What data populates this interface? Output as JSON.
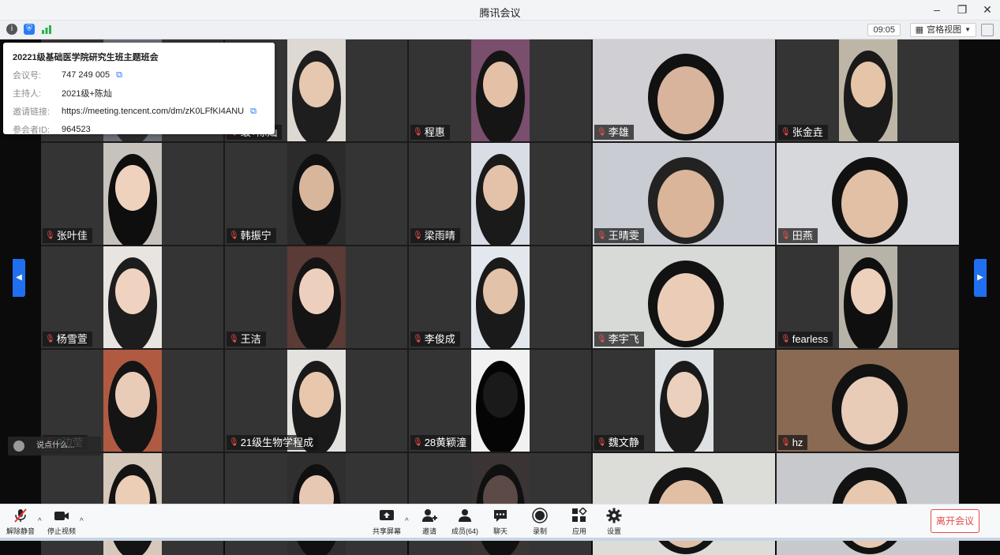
{
  "window": {
    "title": "腾讯会议"
  },
  "subbar": {
    "clock": "09:05",
    "view_label": "宫格视图"
  },
  "meeting_info": {
    "title": "20221级基础医学院研究生班主题班会",
    "rows": [
      {
        "key": "会议号:",
        "value": "747 249 005"
      },
      {
        "key": "主持人:",
        "value": "2021级+陈灿"
      },
      {
        "key": "邀请链接:",
        "value": "https://meeting.tencent.com/dm/zK0LFfKI4ANU"
      },
      {
        "key": "参会者ID:",
        "value": "964523"
      }
    ]
  },
  "participants": [
    {
      "name": ""
    },
    {
      "name": "级+陈灿"
    },
    {
      "name": "程惠"
    },
    {
      "name": "李雄"
    },
    {
      "name": "张金垚"
    },
    {
      "name": "张叶佳"
    },
    {
      "name": "韩振宁"
    },
    {
      "name": "梁雨晴"
    },
    {
      "name": "王晴雯"
    },
    {
      "name": "田燕"
    },
    {
      "name": "杨雪萱"
    },
    {
      "name": "王洁"
    },
    {
      "name": "李俊成"
    },
    {
      "name": "李宇飞"
    },
    {
      "name": "fearless"
    },
    {
      "name": "2边莹"
    },
    {
      "name": "21级生物学程成"
    },
    {
      "name": "28黄颖潼"
    },
    {
      "name": "魏文静"
    },
    {
      "name": "hz"
    },
    {
      "name": ""
    },
    {
      "name": ""
    },
    {
      "name": ""
    },
    {
      "name": ""
    },
    {
      "name": ""
    }
  ],
  "chat": {
    "placeholder": "说点什么..."
  },
  "toolbar": {
    "unmute": "解除静音",
    "stop_video": "停止视频",
    "share": "共享屏幕",
    "invite": "邀请",
    "members": "成员(64)",
    "chat": "聊天",
    "record": "录制",
    "apps": "应用",
    "settings": "设置",
    "leave": "离开会议"
  }
}
